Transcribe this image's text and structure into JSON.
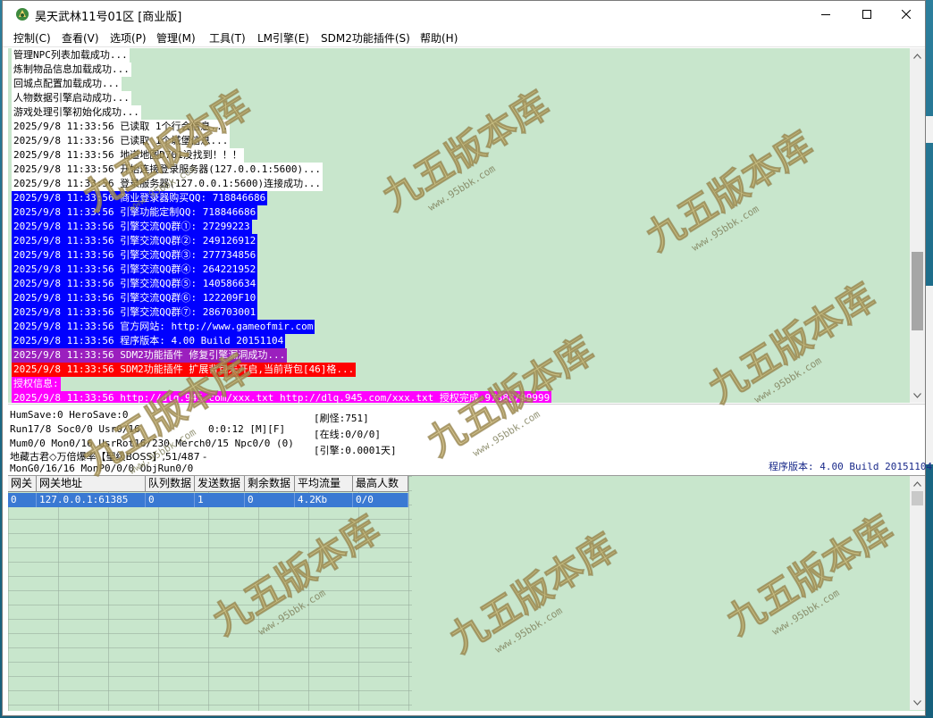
{
  "window": {
    "title": "昊天武林11号01区 [商业版]"
  },
  "menu": [
    {
      "label": "控制(C)"
    },
    {
      "label": "查看(V)"
    },
    {
      "label": "选项(P)"
    },
    {
      "label": "管理(M)"
    },
    {
      "label": "工具(T)"
    },
    {
      "label": "LM引擎(E)"
    },
    {
      "label": "SDM2功能插件(S)"
    },
    {
      "label": "帮助(H)"
    }
  ],
  "log_lines": [
    {
      "text": "管理NPC列表加载成功...",
      "bg": "#ffffff",
      "color": "#000000"
    },
    {
      "text": "炼制物品信息加载成功...",
      "bg": "#ffffff",
      "color": "#000000"
    },
    {
      "text": "回城点配置加载成功...",
      "bg": "#ffffff",
      "color": "#000000"
    },
    {
      "text": "人物数据引擎启动成功...",
      "bg": "#ffffff",
      "color": "#000000"
    },
    {
      "text": "游戏处理引擎初始化成功...",
      "bg": "#ffffff",
      "color": "#000000"
    },
    {
      "text": "2025/9/8 11:33:56 已读取 1个行会信息...",
      "bg": "#ffffff",
      "color": "#000000"
    },
    {
      "text": "2025/9/8 11:33:56 已读取 1个城堡信息...",
      "bg": "#ffffff",
      "color": "#000000"
    },
    {
      "text": "2025/9/8 11:33:56 地道地图D701没找到！！！",
      "bg": "#ffffff",
      "color": "#000000"
    },
    {
      "text": "2025/9/8 11:33:56 开始连接登录服务器(127.0.0.1:5600)...",
      "bg": "#ffffff",
      "color": "#000000"
    },
    {
      "text": "2025/9/8 11:33:56 登录服务器(127.0.0.1:5600)连接成功...",
      "bg": "#ffffff",
      "color": "#000000"
    },
    {
      "text": "2025/9/8 11:33:56 商业登录器购买QQ: 718846686",
      "bg": "#0000ff",
      "color": "#ffffff"
    },
    {
      "text": "2025/9/8 11:33:56 引擎功能定制QQ: 718846686",
      "bg": "#0000ff",
      "color": "#ffffff"
    },
    {
      "text": "2025/9/8 11:33:56 引擎交流QQ群①: 27299223",
      "bg": "#0000ff",
      "color": "#ffffff"
    },
    {
      "text": "2025/9/8 11:33:56 引擎交流QQ群②: 249126912",
      "bg": "#0000ff",
      "color": "#ffffff"
    },
    {
      "text": "2025/9/8 11:33:56 引擎交流QQ群③: 277734856",
      "bg": "#0000ff",
      "color": "#ffffff"
    },
    {
      "text": "2025/9/8 11:33:56 引擎交流QQ群④: 264221952",
      "bg": "#0000ff",
      "color": "#ffffff"
    },
    {
      "text": "2025/9/8 11:33:56 引擎交流QQ群⑤: 140586634",
      "bg": "#0000ff",
      "color": "#ffffff"
    },
    {
      "text": "2025/9/8 11:33:56 引擎交流QQ群⑥: 122209F10",
      "bg": "#0000ff",
      "color": "#ffffff"
    },
    {
      "text": "2025/9/8 11:33:56 引擎交流QQ群⑦: 286703001",
      "bg": "#0000ff",
      "color": "#ffffff"
    },
    {
      "text": "2025/9/8 11:33:56 官方网站: http://www.gameofmir.com",
      "bg": "#0000ff",
      "color": "#ffffff"
    },
    {
      "text": "2025/9/8 11:33:56 程序版本: 4.00 Build 20151104",
      "bg": "#0000ff",
      "color": "#ffffff"
    },
    {
      "text": "2025/9/8 11:33:56 SDM2功能插件 修复引擎漏洞成功...",
      "bg": "#9b1fbe",
      "color": "#ffffff"
    },
    {
      "text": "2025/9/8 11:33:56 SDM2功能插件 扩展背包未开启,当前背包[46]格...",
      "bg": "#ff0000",
      "color": "#ffffff"
    },
    {
      "text": "授权信息:",
      "bg": "#ff00ff",
      "color": "#ffffff"
    },
    {
      "text": "2025/9/8 11:33:56 http://dlq.945.com/xxx.txt http://dlq.945.com/xxx.txt 授权完成:97388/99999",
      "bg": "#ff00ff",
      "color": "#ffffff"
    }
  ],
  "status": {
    "hum_save": "HumSave:0 HeroSave:0",
    "run": "Run17/8 Soc0/0 Usr0/16",
    "timer": "0:0:12 [M][F]",
    "mum": "Mum0/0 Mon0/16 UsrRot16/230 Merch0/15 Npc0/0 (0)",
    "boss": "地藏古君◇万倍爆率【聖级BOSS】,51/487 -",
    "mon": "MonG0/16/16 MonP0/0/0 ObjRun0/0",
    "refresh": "[刷怪:751]",
    "online": "[在线:0/0/0]",
    "engine": "[引擎:0.0001天]",
    "version": "程序版本: 4.00 Build 20151104"
  },
  "gateway_grid": {
    "headers": [
      "网关",
      "网关地址",
      "队列数据",
      "发送数据",
      "剩余数据",
      "平均流量",
      "最高人数"
    ],
    "rows": [
      [
        "0",
        "127.0.0.1:61385",
        "0",
        "1",
        "0",
        "4.2Kb",
        "0/0"
      ]
    ]
  },
  "watermark": {
    "brand": "九五版本库",
    "url": "www.95bbk.com"
  },
  "colors": {
    "log_bg": "#c8e6cc",
    "selection": "#3a79d3",
    "watermark_gold": "#c9b26a"
  }
}
